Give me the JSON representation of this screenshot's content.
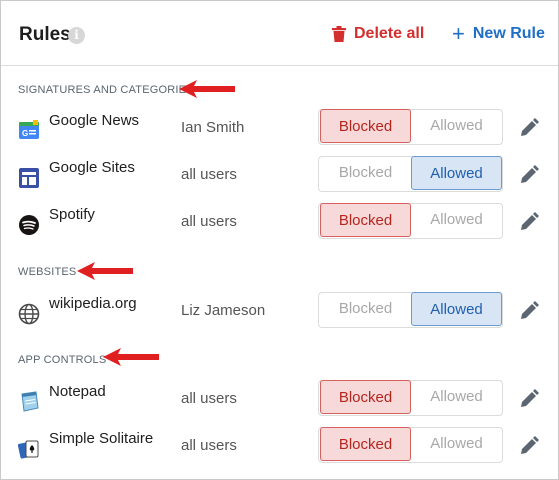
{
  "header": {
    "title": "Rules",
    "info_glyph": "i",
    "delete_all_label": "Delete all",
    "new_rule_label": "New Rule",
    "new_rule_glyph": "+"
  },
  "colors": {
    "blocked_text": "#b3261e",
    "blocked_bg": "#f8d9d9",
    "allowed_text": "#1f5fae",
    "allowed_bg": "#d8e5f5",
    "danger": "#d32f2f",
    "primary": "#1f6fc5",
    "annotation_arrow": "#e02020"
  },
  "sections": [
    {
      "label": "SIGNATURES AND CATEGORIES",
      "rules": [
        {
          "app": "Google News",
          "icon": "google-news-icon",
          "user": "Ian Smith",
          "blocked_label": "Blocked",
          "allowed_label": "Allowed",
          "state": "blocked"
        },
        {
          "app": "Google Sites",
          "icon": "google-sites-icon",
          "user": "all users",
          "blocked_label": "Blocked",
          "allowed_label": "Allowed",
          "state": "allowed"
        },
        {
          "app": "Spotify",
          "icon": "spotify-icon",
          "user": "all users",
          "blocked_label": "Blocked",
          "allowed_label": "Allowed",
          "state": "blocked"
        }
      ]
    },
    {
      "label": "WEBSITES",
      "rules": [
        {
          "app": "wikipedia.org",
          "icon": "globe-icon",
          "user": "Liz Jameson",
          "blocked_label": "Blocked",
          "allowed_label": "Allowed",
          "state": "allowed"
        }
      ]
    },
    {
      "label": "APP CONTROLS",
      "rules": [
        {
          "app": "Notepad",
          "icon": "notepad-icon",
          "user": "all users",
          "blocked_label": "Blocked",
          "allowed_label": "Allowed",
          "state": "blocked"
        },
        {
          "app": "Simple Solitaire",
          "icon": "solitaire-icon",
          "user": "all users",
          "blocked_label": "Blocked",
          "allowed_label": "Allowed",
          "state": "blocked"
        }
      ]
    }
  ]
}
